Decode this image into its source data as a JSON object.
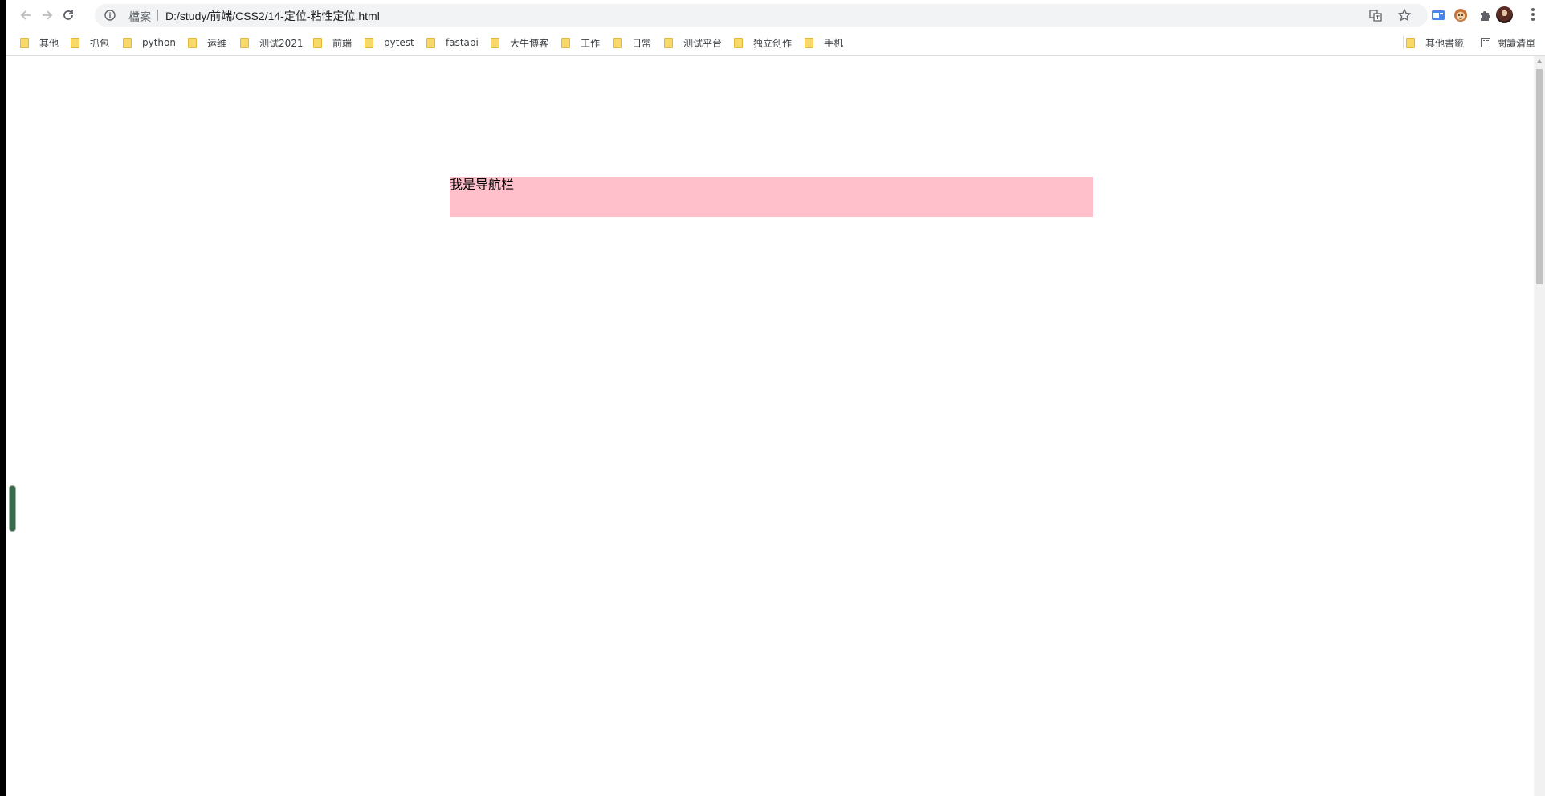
{
  "omnibox": {
    "scheme_label": "檔案",
    "url": "D:/study/前端/CSS2/14-定位-粘性定位.html"
  },
  "toolbar_icons": {
    "back": "back-arrow-icon",
    "forward": "forward-arrow-icon",
    "reload": "reload-icon",
    "info": "info-icon",
    "translate": "translate-icon",
    "star": "star-icon",
    "extensions": [
      "screenshot-extension-icon",
      "monkey-extension-icon",
      "puzzle-extensions-icon"
    ],
    "profile": "profile-avatar",
    "menu": "kebab-menu-icon"
  },
  "bookmarks": {
    "items": [
      "其他",
      "抓包",
      "python",
      "运维",
      "测试2021",
      "前端",
      "pytest",
      "fastapi",
      "大牛博客",
      "工作",
      "日常",
      "测试平台",
      "独立创作",
      "手机"
    ],
    "other_bookmarks": "其他書籤",
    "reading_list": "閱讀清單"
  },
  "page": {
    "navbar_text": "我是导航栏",
    "navbar_color": "#ffc0cb"
  }
}
